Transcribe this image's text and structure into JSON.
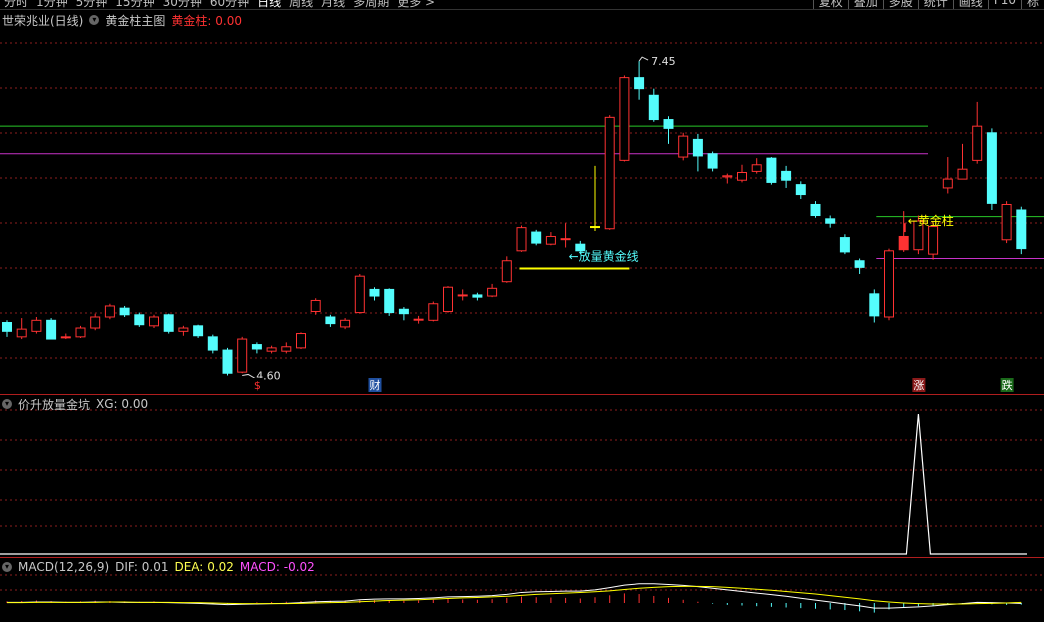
{
  "toolbar": {
    "periods": [
      "分时",
      "1分钟",
      "5分钟",
      "15分钟",
      "30分钟",
      "60分钟",
      "日线",
      "周线",
      "月线",
      "多周期",
      "更多 >"
    ],
    "active_period": "日线",
    "tools": [
      "复权",
      "叠加",
      "多股",
      "统计",
      "画线",
      "F10",
      "标"
    ]
  },
  "main": {
    "stock": "世荣兆业(日线)",
    "indicator_name": "黄金柱主图",
    "param_label": "黄金柱:",
    "param_value": "0.00",
    "high_label": "7.45",
    "low_label": "4.60",
    "annotation_line": "←放量黄金线",
    "annotation_pillar": "←黄金柱",
    "markers": [
      {
        "text": "$",
        "color": "#ff3030",
        "bg": "#000000",
        "idx": 17
      },
      {
        "text": "财",
        "color": "#ffffff",
        "bg": "#1f4f9f",
        "idx": 25
      },
      {
        "text": "涨",
        "color": "#ffffff",
        "bg": "#8a1a1a",
        "idx": 62
      },
      {
        "text": "跌",
        "color": "#ffffff",
        "bg": "#1a6a1a",
        "idx": 68
      }
    ],
    "colors": {
      "up": "#ff3232",
      "down": "#54fcfc",
      "green_line": "#28c828",
      "magenta_line": "#c832c8",
      "yellow": "#ffff00",
      "grid": "#8b1e1e"
    }
  },
  "sub1": {
    "name": "价升放量金坑",
    "xg_label": "XG:",
    "xg_value": "0.00"
  },
  "sub2": {
    "name": "MACD(12,26,9)",
    "dif_label": "DIF:",
    "dif_value": "0.01",
    "dea_label": "DEA:",
    "dea_value": "0.02",
    "macd_label": "MACD:",
    "macd_value": "-0.02"
  },
  "chart_data": {
    "type": "candlestick",
    "ylim": [
      4.45,
      7.75
    ],
    "green_level": 6.86,
    "magenta_level": 6.61,
    "gold_line_level": 5.57,
    "candles": [
      [
        5.08,
        5.0,
        5.1,
        4.95
      ],
      [
        4.95,
        5.02,
        5.12,
        4.93
      ],
      [
        5.0,
        5.1,
        5.13,
        4.98
      ],
      [
        5.1,
        4.93,
        5.12,
        4.93
      ],
      [
        4.95,
        4.95,
        4.98,
        4.93
      ],
      [
        4.95,
        5.03,
        5.05,
        4.94
      ],
      [
        5.03,
        5.13,
        5.16,
        5.01
      ],
      [
        5.13,
        5.23,
        5.25,
        5.11
      ],
      [
        5.21,
        5.15,
        5.23,
        5.13
      ],
      [
        5.15,
        5.06,
        5.17,
        5.04
      ],
      [
        5.05,
        5.13,
        5.15,
        5.03
      ],
      [
        5.15,
        5.0,
        5.16,
        4.98
      ],
      [
        5.0,
        5.03,
        5.05,
        4.96
      ],
      [
        5.05,
        4.96,
        5.06,
        4.94
      ],
      [
        4.95,
        4.83,
        4.97,
        4.8
      ],
      [
        4.83,
        4.62,
        4.85,
        4.6
      ],
      [
        4.63,
        4.93,
        4.95,
        4.62
      ],
      [
        4.88,
        4.84,
        4.9,
        4.8
      ],
      [
        4.82,
        4.85,
        4.87,
        4.8
      ],
      [
        4.82,
        4.86,
        4.9,
        4.8
      ],
      [
        4.85,
        4.98,
        4.99,
        4.84
      ],
      [
        5.18,
        5.28,
        5.3,
        5.15
      ],
      [
        5.13,
        5.07,
        5.15,
        5.04
      ],
      [
        5.04,
        5.1,
        5.12,
        5.02
      ],
      [
        5.17,
        5.5,
        5.52,
        5.16
      ],
      [
        5.38,
        5.32,
        5.4,
        5.28
      ],
      [
        5.38,
        5.17,
        5.39,
        5.14
      ],
      [
        5.2,
        5.16,
        5.22,
        5.1
      ],
      [
        5.11,
        5.11,
        5.14,
        5.07
      ],
      [
        5.1,
        5.25,
        5.27,
        5.09
      ],
      [
        5.18,
        5.4,
        5.41,
        5.17
      ],
      [
        5.33,
        5.33,
        5.38,
        5.28
      ],
      [
        5.33,
        5.31,
        5.35,
        5.28
      ],
      [
        5.32,
        5.39,
        5.43,
        5.31
      ],
      [
        5.45,
        5.64,
        5.68,
        5.44
      ],
      [
        5.73,
        5.94,
        5.96,
        5.72
      ],
      [
        5.9,
        5.8,
        5.92,
        5.78
      ],
      [
        5.79,
        5.86,
        5.9,
        5.78
      ],
      [
        5.84,
        5.84,
        5.98,
        5.76
      ],
      [
        5.79,
        5.73,
        5.82,
        5.7
      ],
      [
        5.95,
        5.95,
        6.5,
        5.91
      ],
      [
        5.93,
        6.94,
        6.96,
        5.92
      ],
      [
        6.55,
        7.3,
        7.32,
        6.54
      ],
      [
        7.3,
        7.2,
        7.45,
        7.1
      ],
      [
        7.14,
        6.92,
        7.2,
        6.9
      ],
      [
        6.92,
        6.84,
        6.95,
        6.7
      ],
      [
        6.58,
        6.77,
        6.8,
        6.55
      ],
      [
        6.74,
        6.59,
        6.79,
        6.45
      ],
      [
        6.61,
        6.48,
        6.63,
        6.45
      ],
      [
        6.4,
        6.41,
        6.43,
        6.34
      ],
      [
        6.37,
        6.44,
        6.51,
        6.35
      ],
      [
        6.45,
        6.51,
        6.57,
        6.43
      ],
      [
        6.57,
        6.35,
        6.58,
        6.33
      ],
      [
        6.45,
        6.37,
        6.5,
        6.3
      ],
      [
        6.33,
        6.24,
        6.36,
        6.2
      ],
      [
        6.15,
        6.05,
        6.18,
        6.03
      ],
      [
        6.02,
        5.98,
        6.05,
        5.94
      ],
      [
        5.85,
        5.72,
        5.88,
        5.7
      ],
      [
        5.64,
        5.58,
        5.66,
        5.52
      ],
      [
        5.34,
        5.14,
        5.38,
        5.08
      ],
      [
        5.13,
        5.73,
        5.75,
        5.1
      ],
      [
        5.86,
        5.74,
        6.09,
        5.72
      ],
      [
        5.74,
        6.0,
        6.05,
        5.7
      ],
      [
        5.7,
        5.95,
        6.0,
        5.65
      ],
      [
        6.3,
        6.38,
        6.58,
        6.25
      ],
      [
        6.38,
        6.47,
        6.7,
        6.4
      ],
      [
        6.55,
        6.86,
        7.08,
        6.52
      ],
      [
        6.8,
        6.16,
        6.84,
        6.1
      ],
      [
        5.83,
        6.15,
        6.18,
        5.8
      ],
      [
        6.1,
        5.75,
        6.13,
        5.7
      ]
    ],
    "xg_spike_idx": 62,
    "macd_hist": [
      0.05,
      0.06,
      0.08,
      0.06,
      0.04,
      0.05,
      0.07,
      0.06,
      0.05,
      0.04,
      0.05,
      0.03,
      0.02,
      0.01,
      -0.01,
      -0.03,
      0.0,
      0.02,
      0.03,
      0.04,
      0.06,
      0.08,
      0.07,
      0.08,
      0.1,
      0.09,
      0.08,
      0.07,
      0.08,
      0.1,
      0.12,
      0.11,
      0.1,
      0.12,
      0.16,
      0.2,
      0.18,
      0.17,
      0.16,
      0.14,
      0.18,
      0.24,
      0.3,
      0.28,
      0.22,
      0.16,
      0.1,
      0.04,
      -0.02,
      -0.06,
      -0.08,
      -0.1,
      -0.12,
      -0.14,
      -0.16,
      -0.18,
      -0.2,
      -0.22,
      -0.26,
      -0.3,
      -0.2,
      -0.14,
      -0.1,
      -0.08,
      -0.04,
      -0.02,
      0.0,
      -0.04,
      -0.06,
      -0.05
    ],
    "macd_dif": [
      0.02,
      0.02,
      0.03,
      0.03,
      0.02,
      0.02,
      0.03,
      0.03,
      0.02,
      0.02,
      0.02,
      0.01,
      0.0,
      -0.01,
      -0.03,
      -0.05,
      -0.04,
      -0.03,
      -0.02,
      -0.01,
      0.01,
      0.04,
      0.05,
      0.06,
      0.1,
      0.12,
      0.13,
      0.13,
      0.14,
      0.16,
      0.19,
      0.2,
      0.21,
      0.23,
      0.27,
      0.33,
      0.35,
      0.36,
      0.37,
      0.37,
      0.41,
      0.48,
      0.56,
      0.6,
      0.6,
      0.58,
      0.55,
      0.51,
      0.46,
      0.41,
      0.36,
      0.31,
      0.26,
      0.21,
      0.15,
      0.09,
      0.03,
      -0.03,
      -0.09,
      -0.16,
      -0.16,
      -0.14,
      -0.12,
      -0.09,
      -0.05,
      -0.02,
      0.02,
      0.01,
      0.0,
      -0.01
    ],
    "macd_dea": [
      0.01,
      0.01,
      0.02,
      0.02,
      0.02,
      0.02,
      0.02,
      0.03,
      0.03,
      0.02,
      0.02,
      0.02,
      0.01,
      0.01,
      0.0,
      -0.01,
      -0.02,
      -0.02,
      -0.02,
      -0.02,
      -0.01,
      0.0,
      0.01,
      0.02,
      0.04,
      0.06,
      0.08,
      0.09,
      0.1,
      0.12,
      0.14,
      0.16,
      0.17,
      0.19,
      0.21,
      0.24,
      0.27,
      0.29,
      0.31,
      0.33,
      0.35,
      0.38,
      0.42,
      0.46,
      0.49,
      0.51,
      0.52,
      0.52,
      0.51,
      0.49,
      0.46,
      0.43,
      0.4,
      0.36,
      0.32,
      0.28,
      0.23,
      0.18,
      0.13,
      0.07,
      0.03,
      0.0,
      -0.02,
      -0.03,
      -0.03,
      -0.03,
      -0.02,
      -0.01,
      0.0,
      0.02
    ]
  }
}
